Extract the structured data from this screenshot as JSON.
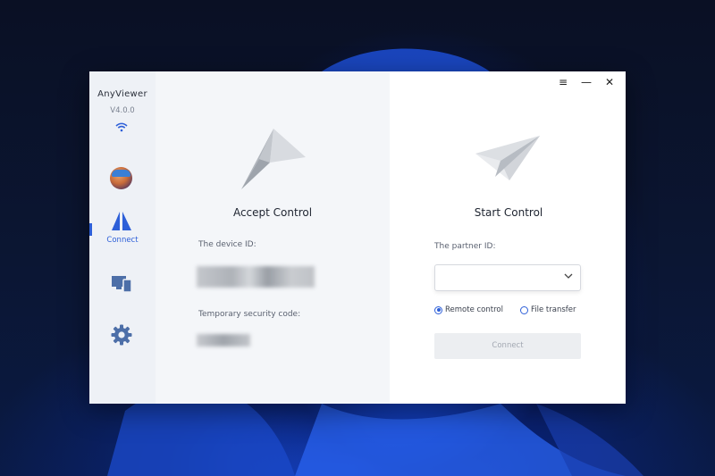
{
  "app": {
    "name": "AnyViewer",
    "version": "V4.0.0"
  },
  "sidebar": {
    "connect_label": "Connect"
  },
  "window_controls": {
    "menu": "≡",
    "minimize": "—",
    "close": "✕"
  },
  "accept": {
    "title": "Accept Control",
    "device_id_label": "The device ID:",
    "security_code_label": "Temporary security code:"
  },
  "start": {
    "title": "Start Control",
    "partner_id_label": "The partner ID:",
    "partner_id_value": "",
    "radio_remote": "Remote control",
    "radio_file": "File transfer",
    "connect_button": "Connect"
  },
  "colors": {
    "accent": "#2d5fd8",
    "sidebar_bg": "#eef1f6",
    "left_panel_bg": "#f4f6f9"
  }
}
